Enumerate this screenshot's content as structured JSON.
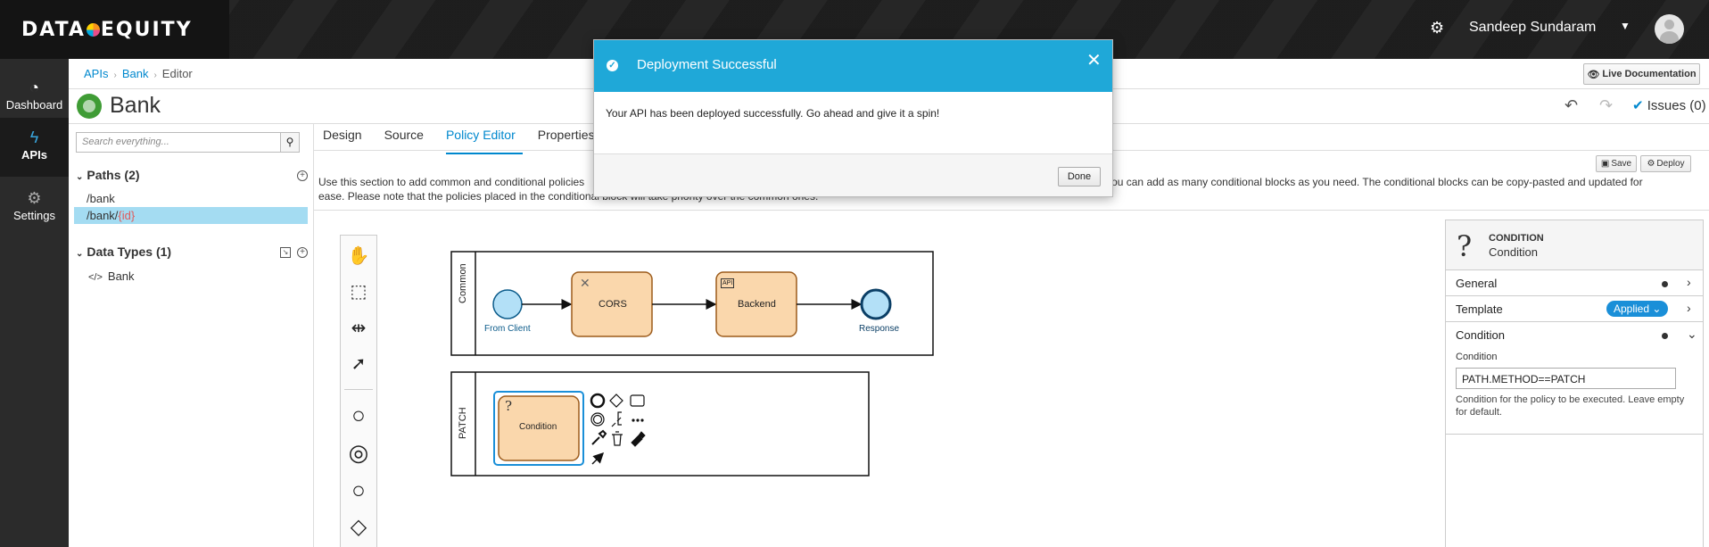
{
  "brand": {
    "logo_text_left": "DATA",
    "logo_text_right": "EQUITY"
  },
  "header": {
    "user_name": "Sandeep Sundaram"
  },
  "nav": {
    "items": [
      {
        "label": "Dashboard",
        "icon": "dashboard-icon"
      },
      {
        "label": "APIs",
        "icon": "bolt-icon"
      },
      {
        "label": "Settings",
        "icon": "gears-icon"
      }
    ]
  },
  "breadcrumb": {
    "items": [
      "APIs",
      "Bank",
      "Editor"
    ]
  },
  "live_doc": {
    "label": "Live Documentation"
  },
  "api": {
    "title": "Bank"
  },
  "issues": {
    "label": "Issues (0)"
  },
  "left_panel": {
    "search_placeholder": "Search everything...",
    "paths_header": "Paths (2)",
    "paths": [
      {
        "prefix": "/bank",
        "param": ""
      },
      {
        "prefix": "/bank/",
        "param": "{id}"
      }
    ],
    "datatypes_header": "Data Types (1)",
    "datatypes": [
      "Bank"
    ]
  },
  "tabs": [
    "Design",
    "Source",
    "Policy Editor",
    "Properties"
  ],
  "toolbar": {
    "save_label": "Save",
    "deploy_label": "Deploy"
  },
  "description": "Use this section to add common and conditional policies",
  "description_rest": "You can add as many conditional blocks as you need. The conditional blocks can be copy-pasted and updated for",
  "description_line2": "ease. Please note that the policies placed in the conditional block will take priority over the common ones.",
  "canvas": {
    "lane1_label": "Common",
    "lane2_label": "PATCH",
    "from_client": "From Client",
    "cors": "CORS",
    "backend": "Backend",
    "response": "Response",
    "condition": "Condition",
    "api_badge": "API"
  },
  "properties": {
    "type": "CONDITION",
    "name": "Condition",
    "rows": {
      "general": "General",
      "template": "Template",
      "condition": "Condition"
    },
    "applied_label": "Applied",
    "condition_field_label": "Condition",
    "condition_value": "PATH.METHOD==PATCH",
    "condition_help": "Condition for the policy to be executed. Leave empty for default."
  },
  "modal": {
    "title": "Deployment Successful",
    "body": "Your API has been deployed successfully. Go ahead and give it a spin!",
    "done_label": "Done"
  },
  "colors": {
    "accent": "#0088ce",
    "modal_header": "#1fa8d8",
    "node_fill": "#fad7ac",
    "node_stroke": "#9c5b1b",
    "event_fill": "#b3e0f7"
  }
}
